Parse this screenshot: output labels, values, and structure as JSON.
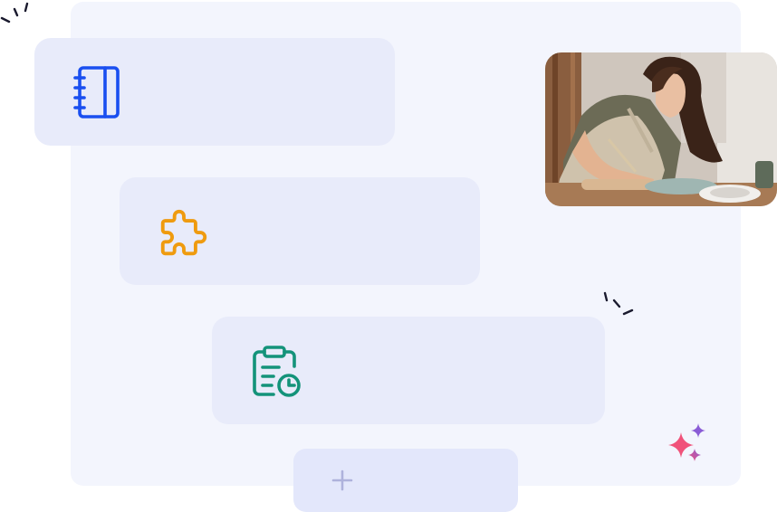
{
  "colors": {
    "board": "#f3f5fd",
    "card": "#e8ebfa",
    "add_card": "#e3e7fb",
    "notebook_icon": "#1a4ff0",
    "puzzle_icon": "#ef9b0f",
    "clipboard_icon": "#14937a",
    "plus_icon": "#aeb2dc",
    "spark_lines": "#1a1a2e",
    "sparkle_pink": "#f0527a",
    "sparkle_purple": "#8a5cd6"
  },
  "cards": [
    {
      "icon": "notebook-icon"
    },
    {
      "icon": "puzzle-icon"
    },
    {
      "icon": "clipboard-chart-icon"
    }
  ],
  "add_card": {
    "icon": "plus-icon"
  },
  "photo": {
    "subject": "woman-painting-pottery"
  },
  "decorations": [
    "spark-lines-icon",
    "sparkles-icon"
  ]
}
